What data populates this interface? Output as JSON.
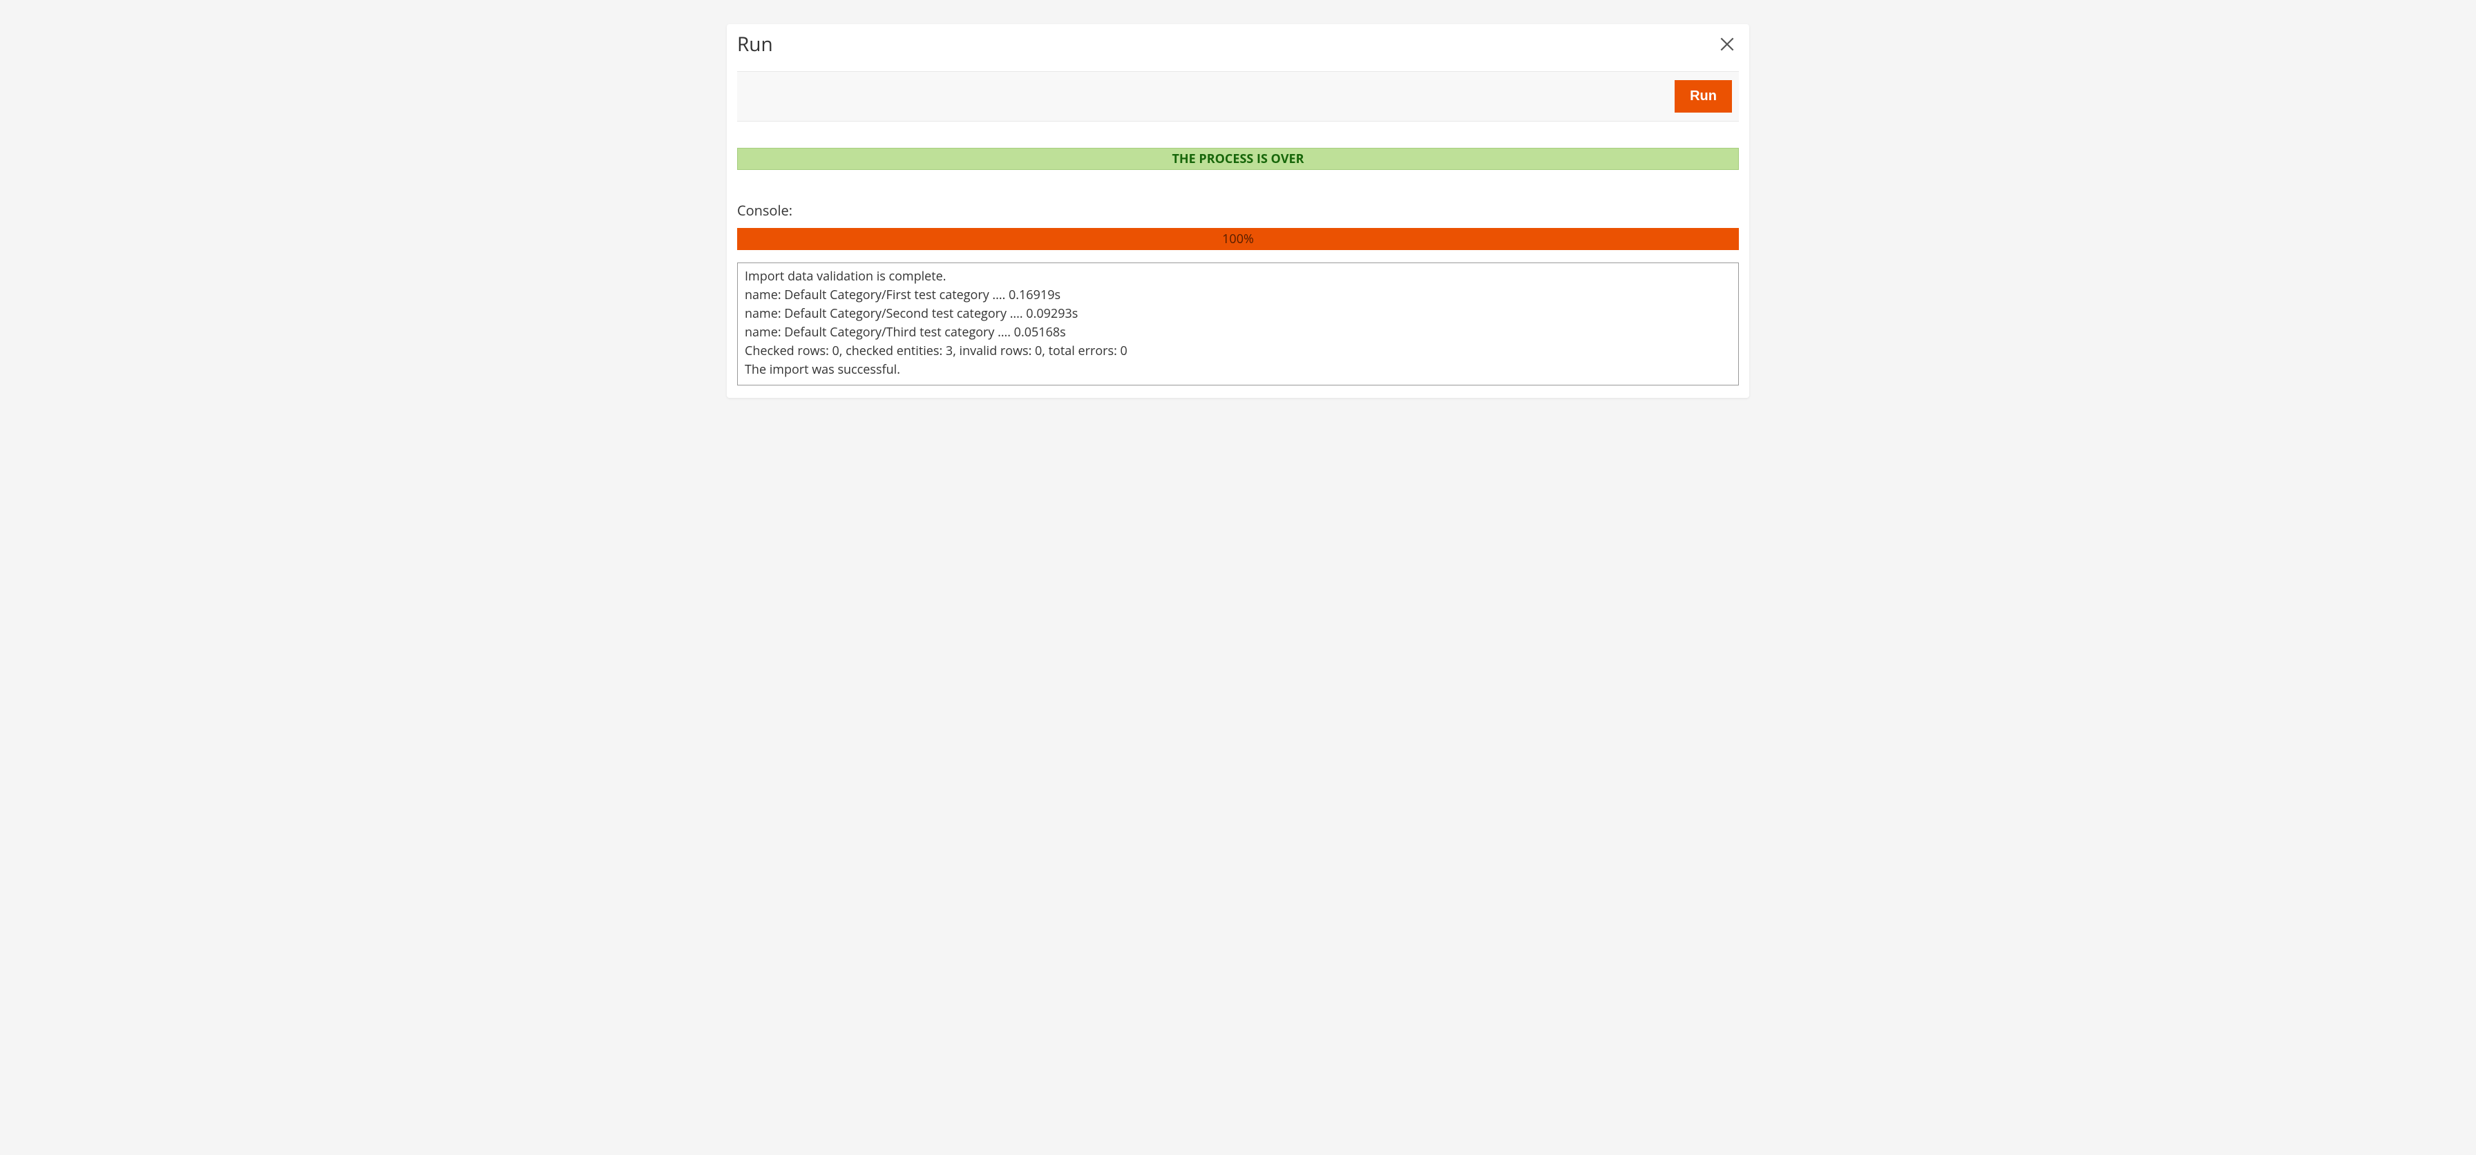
{
  "modal": {
    "title": "Run"
  },
  "toolbar": {
    "run_label": "Run"
  },
  "status": {
    "message": "THE PROCESS IS OVER"
  },
  "console": {
    "label": "Console:",
    "progress_percent": "100%",
    "lines": [
      "Import data validation is complete.",
      "name: Default Category/First test category .... 0.16919s",
      "name: Default Category/Second test category .... 0.09293s",
      "name: Default Category/Third test category .... 0.05168s",
      "Checked rows: 0, checked entities: 3, invalid rows: 0, total errors: 0",
      "The import was successful."
    ]
  }
}
